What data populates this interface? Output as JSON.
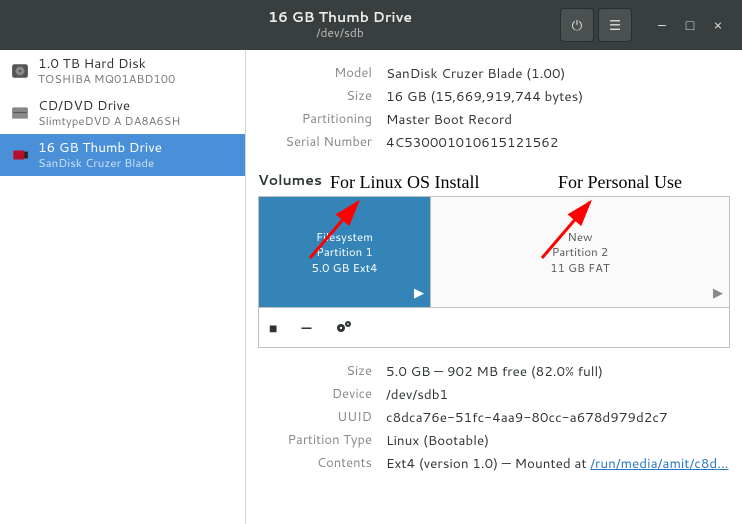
{
  "titlebar": {
    "title": "16 GB Thumb Drive",
    "subtitle": "/dev/sdb"
  },
  "devices": [
    {
      "name": "1.0 TB Hard Disk",
      "sub": "TOSHIBA MQ01ABD100"
    },
    {
      "name": "CD/DVD Drive",
      "sub": "SlimtypeDVD A  DA8A6SH"
    },
    {
      "name": "16 GB Thumb Drive",
      "sub": "SanDisk Cruzer Blade"
    }
  ],
  "info": {
    "model_k": "Model",
    "model_v": "SanDisk Cruzer Blade (1.00)",
    "size_k": "Size",
    "size_v": "16 GB (15,669,919,744 bytes)",
    "part_k": "Partitioning",
    "part_v": "Master Boot Record",
    "serial_k": "Serial Number",
    "serial_v": "4C530001010615121562"
  },
  "volumes_label": "Volumes",
  "partitions": {
    "p1_l1": "Filesystem",
    "p1_l2": "Partition 1",
    "p1_l3": "5.0 GB Ext4",
    "p2_l1": "New",
    "p2_l2": "Partition 2",
    "p2_l3": "11 GB FAT"
  },
  "partinfo": {
    "size_k": "Size",
    "size_v": "5.0 GB — 902 MB free (82.0% full)",
    "dev_k": "Device",
    "dev_v": "/dev/sdb1",
    "uuid_k": "UUID",
    "uuid_v": "c8dca76e-51fc-4aa9-80cc-a678d979d2c7",
    "ptype_k": "Partition Type",
    "ptype_v": "Linux (Bootable)",
    "cont_k": "Contents",
    "cont_prefix": "Ext4 (version 1.0) — Mounted at ",
    "cont_link": "/run/media/amit/c8d…"
  },
  "annotations": {
    "a1": "For Linux OS Install",
    "a2": "For Personal Use"
  }
}
